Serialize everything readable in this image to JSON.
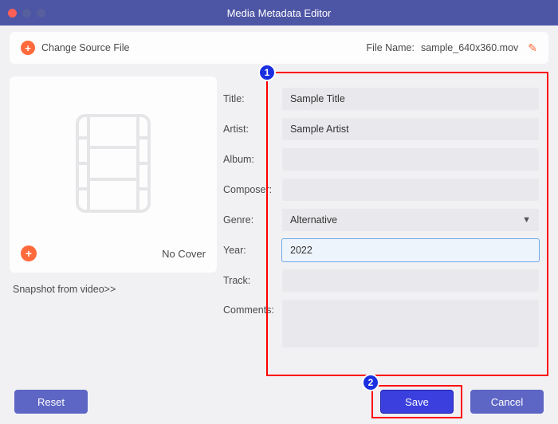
{
  "window": {
    "title": "Media Metadata Editor"
  },
  "toolbar": {
    "change_source_label": "Change Source File",
    "filename_label": "File Name:",
    "filename_value": "sample_640x360.mov"
  },
  "cover": {
    "no_cover_label": "No Cover",
    "snapshot_link": "Snapshot from video>>"
  },
  "form": {
    "labels": {
      "title": "Title:",
      "artist": "Artist:",
      "album": "Album:",
      "composer": "Composer:",
      "genre": "Genre:",
      "year": "Year:",
      "track": "Track:",
      "comments": "Comments:"
    },
    "values": {
      "title": "Sample Title",
      "artist": "Sample Artist",
      "album": "",
      "composer": "",
      "genre": "Alternative",
      "year": "2022",
      "track": "",
      "comments": ""
    }
  },
  "buttons": {
    "reset": "Reset",
    "save": "Save",
    "cancel": "Cancel"
  },
  "annotations": {
    "step1": "1",
    "step2": "2"
  }
}
